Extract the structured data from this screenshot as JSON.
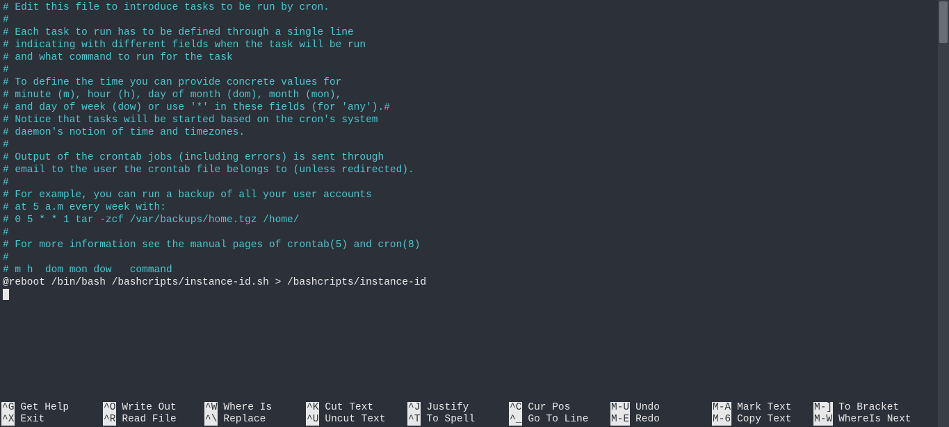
{
  "lines": [
    {
      "type": "comment",
      "text": "# Edit this file to introduce tasks to be run by cron."
    },
    {
      "type": "comment",
      "text": "#"
    },
    {
      "type": "comment",
      "text": "# Each task to run has to be defined through a single line"
    },
    {
      "type": "comment",
      "text": "# indicating with different fields when the task will be run"
    },
    {
      "type": "comment",
      "text": "# and what command to run for the task"
    },
    {
      "type": "comment",
      "text": "#"
    },
    {
      "type": "comment",
      "text": "# To define the time you can provide concrete values for"
    },
    {
      "type": "comment",
      "text": "# minute (m), hour (h), day of month (dom), month (mon),"
    },
    {
      "type": "comment",
      "text": "# and day of week (dow) or use '*' in these fields (for 'any').#"
    },
    {
      "type": "comment",
      "text": "# Notice that tasks will be started based on the cron's system"
    },
    {
      "type": "comment",
      "text": "# daemon's notion of time and timezones."
    },
    {
      "type": "comment",
      "text": "#"
    },
    {
      "type": "comment",
      "text": "# Output of the crontab jobs (including errors) is sent through"
    },
    {
      "type": "comment",
      "text": "# email to the user the crontab file belongs to (unless redirected)."
    },
    {
      "type": "comment",
      "text": "#"
    },
    {
      "type": "comment",
      "text": "# For example, you can run a backup of all your user accounts"
    },
    {
      "type": "comment",
      "text": "# at 5 a.m every week with:"
    },
    {
      "type": "comment",
      "text": "# 0 5 * * 1 tar -zcf /var/backups/home.tgz /home/"
    },
    {
      "type": "comment",
      "text": "#"
    },
    {
      "type": "comment",
      "text": "# For more information see the manual pages of crontab(5) and cron(8)"
    },
    {
      "type": "comment",
      "text": "#"
    },
    {
      "type": "comment",
      "text": "# m h  dom mon dow   command"
    },
    {
      "type": "normal",
      "text": "@reboot /bin/bash /bashcripts/instance-id.sh > /bashcripts/instance-id"
    }
  ],
  "menu": {
    "row1": [
      {
        "key": "^G",
        "label": "Get Help",
        "width": 146
      },
      {
        "key": "^O",
        "label": "Write Out",
        "width": 146
      },
      {
        "key": "^W",
        "label": "Where Is",
        "width": 146
      },
      {
        "key": "^K",
        "label": "Cut Text",
        "width": 146
      },
      {
        "key": "^J",
        "label": "Justify",
        "width": 146
      },
      {
        "key": "^C",
        "label": "Cur Pos",
        "width": 146
      },
      {
        "key": "M-U",
        "label": "Undo",
        "width": 146
      },
      {
        "key": "M-A",
        "label": "Mark Text",
        "width": 146
      },
      {
        "key": "M-]",
        "label": "To Bracket",
        "width": 146
      }
    ],
    "row2": [
      {
        "key": "^X",
        "label": "Exit",
        "width": 146
      },
      {
        "key": "^R",
        "label": "Read File",
        "width": 146
      },
      {
        "key": "^\\",
        "label": "Replace",
        "width": 146
      },
      {
        "key": "^U",
        "label": "Uncut Text",
        "width": 146
      },
      {
        "key": "^T",
        "label": "To Spell",
        "width": 146
      },
      {
        "key": "^_",
        "label": "Go To Line",
        "width": 146
      },
      {
        "key": "M-E",
        "label": "Redo",
        "width": 146
      },
      {
        "key": "M-6",
        "label": "Copy Text",
        "width": 146
      },
      {
        "key": "M-W",
        "label": "WhereIs Next",
        "width": 146
      }
    ]
  }
}
